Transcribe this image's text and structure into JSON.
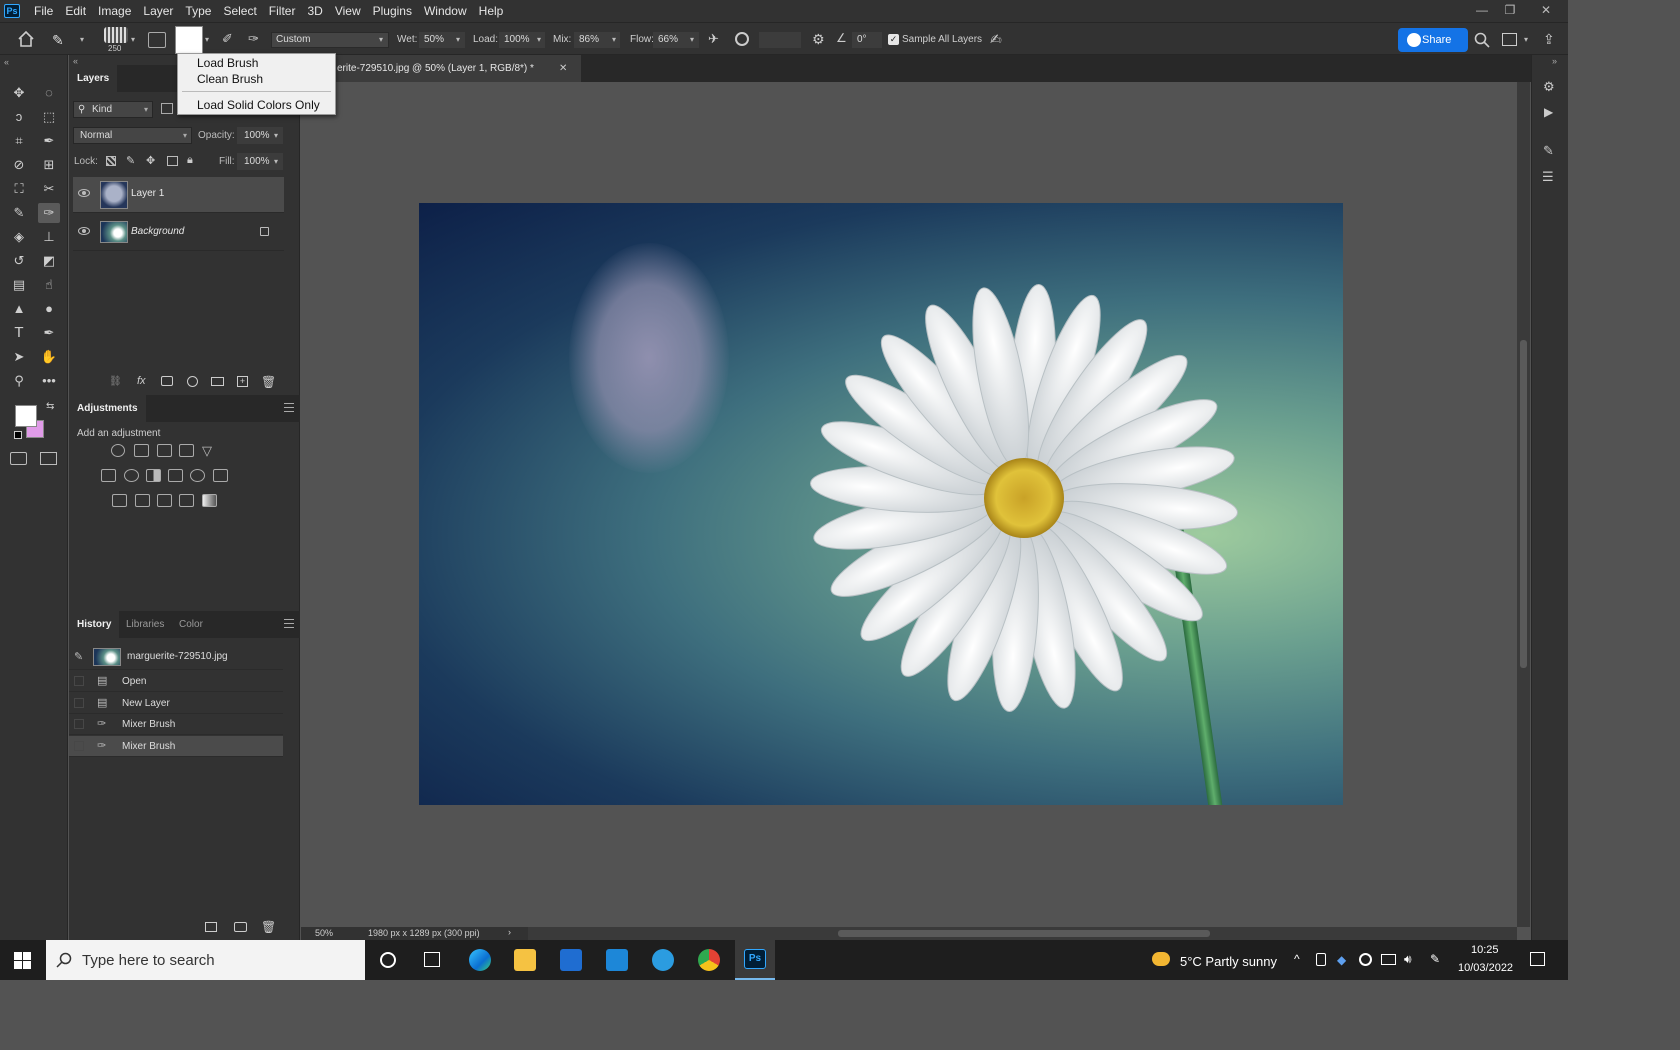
{
  "menubar": {
    "logo": "Ps",
    "items": [
      "File",
      "Edit",
      "Image",
      "Layer",
      "Type",
      "Select",
      "Filter",
      "3D",
      "View",
      "Plugins",
      "Window",
      "Help"
    ]
  },
  "options_bar": {
    "brush_size": "250",
    "preset": "Custom",
    "wet_label": "Wet:",
    "wet_value": "50%",
    "load_label": "Load:",
    "load_value": "100%",
    "mix_label": "Mix:",
    "mix_value": "86%",
    "flow_label": "Flow:",
    "flow_value": "66%",
    "angle_value": "0°",
    "sample_all_layers_label": "Sample All Layers",
    "sample_all_layers_checked": true,
    "share_label": "Share"
  },
  "brush_dropdown": {
    "items": [
      "Load Brush",
      "Clean Brush",
      "Load Solid Colors Only"
    ]
  },
  "document": {
    "tab_title": "erite-729510.jpg @ 50% (Layer 1, RGB/8*) *",
    "zoom": "50%",
    "info": "1980 px x 1289 px (300 ppi)"
  },
  "layers_panel": {
    "tab": "Layers",
    "filter_kind": "Kind",
    "blend_mode": "Normal",
    "opacity_label": "Opacity:",
    "opacity_value": "100%",
    "lock_label": "Lock:",
    "fill_label": "Fill:",
    "fill_value": "100%",
    "layers": [
      {
        "name": "Layer 1",
        "selected": true
      },
      {
        "name": "Background",
        "selected": false,
        "locked": true
      }
    ]
  },
  "adjustments_panel": {
    "tab": "Adjustments",
    "hint": "Add an adjustment"
  },
  "history_panel": {
    "tabs": [
      "History",
      "Libraries",
      "Color"
    ],
    "snapshot": "marguerite-729510.jpg",
    "states": [
      "Open",
      "New Layer",
      "Mixer Brush",
      "Mixer Brush"
    ],
    "selected_index": 3
  },
  "colors": {
    "foreground": "#ffffff",
    "background": "#e09be8",
    "accent": "#1473e6"
  },
  "taskbar": {
    "search_placeholder": "Type here to search",
    "weather": "5°C  Partly sunny",
    "time": "10:25",
    "date": "10/03/2022"
  }
}
